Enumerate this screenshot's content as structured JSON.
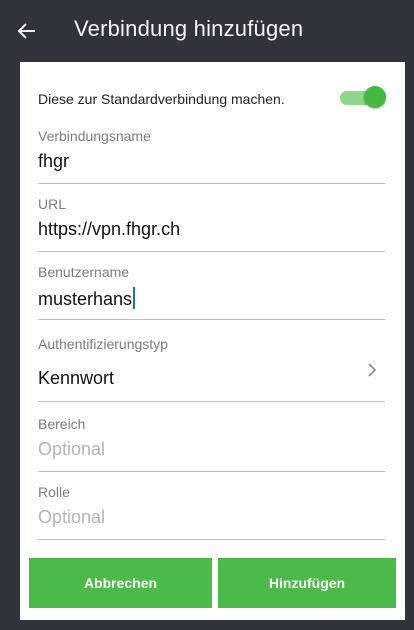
{
  "app_bar": {
    "title": "Verbindung hinzufügen",
    "back_icon": "arrow-left-icon"
  },
  "toggle": {
    "label": "Diese zur Standardverbindung machen.",
    "on": true,
    "color": "#45b93f"
  },
  "fields": {
    "name": {
      "label": "Verbindungsname",
      "value": "fhgr"
    },
    "url": {
      "label": "URL",
      "value": "https://vpn.fhgr.ch"
    },
    "user": {
      "label": "Benutzername",
      "value": "musterhans"
    },
    "auth": {
      "label": "Authentifizierungstyp",
      "value": "Kennwort",
      "icon": "chevron-right-icon"
    },
    "realm": {
      "label": "Bereich",
      "placeholder": "Optional"
    },
    "role": {
      "label": "Rolle",
      "placeholder": "Optional"
    }
  },
  "buttons": {
    "cancel": "Abbrechen",
    "add": "Hinzufügen"
  },
  "colors": {
    "app_bar": "#2f343a",
    "accent": "#4cba48"
  }
}
